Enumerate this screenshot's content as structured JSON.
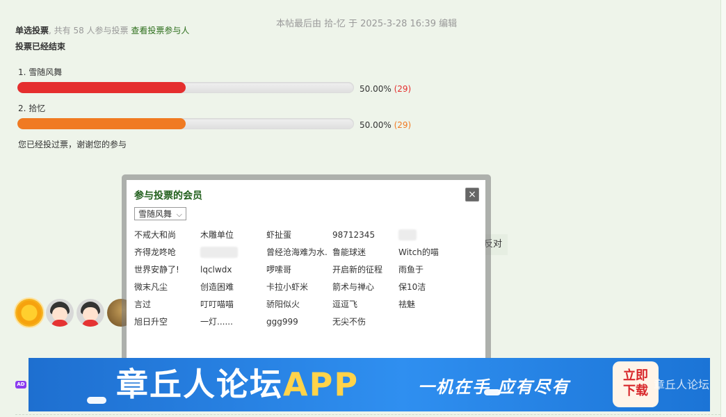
{
  "post": {
    "edit_note": "本帖最后由 拾-忆 于 2025-3-28 16:39 编辑"
  },
  "poll": {
    "type_label": "单选投票",
    "count_text": ", 共有 58 人参与投票",
    "view_voters_link": "查看投票参与人",
    "ended_label": "投票已经结束",
    "options": [
      {
        "label": "1.  雪随风舞",
        "percent": 50,
        "percent_text": "50.00%",
        "count_text": "(29)",
        "color": "#e52e2e"
      },
      {
        "label": "2.  拾忆",
        "percent": 50,
        "percent_text": "50.00%",
        "count_text": "(29)",
        "color": "#f07a22"
      }
    ],
    "voted_note": "您已经投过票，谢谢您的参与"
  },
  "oppose_label": "反对",
  "voters_popup": {
    "title": "参与投票的会员",
    "close_label": "×",
    "filter_selected": "雪随风舞",
    "members": [
      [
        "不戒大和尚",
        "木雕单位",
        "虾扯蛋",
        "98712345",
        ""
      ],
      [
        "齐得龙咚呛",
        "",
        "曾经沧海难为水.",
        "鲁能球迷",
        "Witch的喵"
      ],
      [
        "世界安静了!",
        "lqclwdx",
        "啰嗦哥",
        "开启新的征程",
        "雨鱼于"
      ],
      [
        "微末凡尘",
        "创造困难",
        "卡拉小虾米",
        "箭术与禅心",
        "保10洁"
      ],
      [
        "言过",
        "叮叮喵喵",
        "骄阳似火",
        "逗逗飞",
        "祛魅"
      ],
      [
        "旭日升空",
        "一灯......",
        "ggg999",
        "无尖不伤",
        ""
      ]
    ]
  },
  "ad": {
    "badge": "AD",
    "title_main": "章丘人论坛",
    "title_app": "APP",
    "slogan": "一机在手  应有尽有",
    "button_line1": "立即",
    "button_line2": "下载",
    "watermark": "章丘人论坛"
  }
}
